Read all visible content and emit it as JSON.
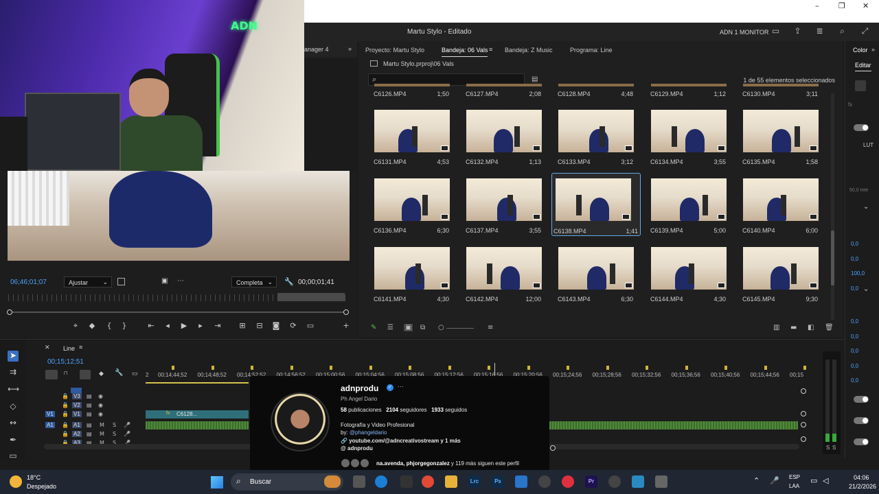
{
  "window": {
    "title": "Martu Stylo - Editado",
    "workspace": "ADN 1 MONITOR"
  },
  "webcam": {
    "neon_sign": "ADN"
  },
  "source_monitor": {
    "tab_stub": "anager 4",
    "timecode": "06;46;01;07",
    "fit_label": "Ajustar",
    "quality_label": "Completa",
    "duration": "00;00;01;41"
  },
  "project_panel": {
    "tabs": [
      {
        "label": "Proyecto: Martu Stylo",
        "active": false
      },
      {
        "label": "Bandeja: 06 Vals",
        "active": true
      },
      {
        "label": "Bandeja: Z Music",
        "active": false
      },
      {
        "label": "Programa: Line",
        "active": false
      }
    ],
    "path": "Martu Stylo.prproj\\06 Vals",
    "search_placeholder": "",
    "selection_count": "1 de 55 elementos seleccionados",
    "top_row": [
      {
        "name": "C6126.MP4",
        "duration": "1;50"
      },
      {
        "name": "C6127.MP4",
        "duration": "2;08"
      },
      {
        "name": "C6128.MP4",
        "duration": "4;48"
      },
      {
        "name": "C6129.MP4",
        "duration": "1;12"
      },
      {
        "name": "C6130.MP4",
        "duration": "3;11"
      }
    ],
    "clips": [
      {
        "name": "C6131.MP4",
        "duration": "4;53",
        "selected": false
      },
      {
        "name": "C6132.MP4",
        "duration": "1;13",
        "selected": false
      },
      {
        "name": "C6133.MP4",
        "duration": "3;12",
        "selected": false
      },
      {
        "name": "C6134.MP4",
        "duration": "3;55",
        "selected": false
      },
      {
        "name": "C6135.MP4",
        "duration": "1;58",
        "selected": false
      },
      {
        "name": "C6136.MP4",
        "duration": "6;30",
        "selected": false
      },
      {
        "name": "C6137.MP4",
        "duration": "3;55",
        "selected": false
      },
      {
        "name": "C6138.MP4",
        "duration": "1;41",
        "selected": true
      },
      {
        "name": "C6139.MP4",
        "duration": "5;00",
        "selected": false
      },
      {
        "name": "C6140.MP4",
        "duration": "6;00",
        "selected": false
      },
      {
        "name": "C6141.MP4",
        "duration": "4;30",
        "selected": false
      },
      {
        "name": "C6142.MP4",
        "duration": "12;00",
        "selected": false
      },
      {
        "name": "C6143.MP4",
        "duration": "6;30",
        "selected": false
      },
      {
        "name": "C6144.MP4",
        "duration": "4;30",
        "selected": false
      },
      {
        "name": "C6145.MP4",
        "duration": "9;30",
        "selected": false
      }
    ]
  },
  "right_panel": {
    "tab": "Color",
    "edit_label": "Editar",
    "lut_label": "LUT",
    "intensity_label": "50,0 Inte",
    "values": [
      "0,0",
      "0,0",
      "100,0",
      "0,0",
      "0,0",
      "0,0",
      "0,0",
      "0,0",
      "0,0",
      "0,0"
    ]
  },
  "timeline": {
    "sequence_name": "Line",
    "timecode": "00;15;12;51",
    "ruler_labels": [
      "2",
      "00;14;44;52",
      "00;14;48;52",
      "00;14;52;52",
      "00;14;56;52",
      "00;15;00;56",
      "00;15;04;56",
      "00;15;08;56",
      "00;15;12;56",
      "00;15;16;56",
      "00;15;20;56",
      "00;15;24;56",
      "00;15;28;56",
      "00;15;32;56",
      "00;15;36;56",
      "00;15;40;56",
      "00;15;44;56",
      "00;15"
    ],
    "tracks": [
      {
        "label": "V3",
        "kind": "video"
      },
      {
        "label": "V2",
        "kind": "video"
      },
      {
        "label": "V1",
        "kind": "video",
        "target": "V1"
      },
      {
        "label": "A1",
        "kind": "audio",
        "target": "A1"
      },
      {
        "label": "A2",
        "kind": "audio"
      },
      {
        "label": "A3",
        "kind": "audio"
      }
    ],
    "v1_clip_label": "C6128...",
    "meter_labels": [
      "S",
      "S"
    ]
  },
  "profile_card": {
    "handle": "adnprodu",
    "name": "Ph Angel Dario",
    "posts": "58",
    "posts_label": "publicaciones",
    "followers": "2104",
    "followers_label": "seguidores",
    "following": "1933",
    "following_label": "seguidos",
    "bio": "Fotografía y Video Profesional",
    "by_prefix": "by:",
    "by_handle": "@phangeldario",
    "link": "youtube.com/@adncreativostream y 1 más",
    "threads": "adnprodu",
    "followed_by_names": "na.avenda, phjorgegonzalez",
    "followed_by_rest": "y 119 más siguen este perfil"
  },
  "taskbar": {
    "temperature": "18°C",
    "weather": "Despejado",
    "search": "Buscar",
    "language": "ESP",
    "region": "LAA",
    "time": "04:06",
    "date": "21/2/2026",
    "apps": [
      "Lrc",
      "Ps",
      "Pr"
    ]
  }
}
